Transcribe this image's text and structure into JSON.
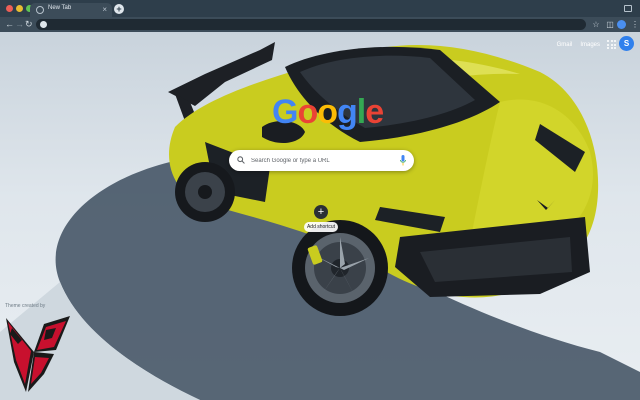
{
  "browser": {
    "tab": {
      "title": "New Tab",
      "close_glyph": "×"
    },
    "new_tab_glyph": "+",
    "omnibox": {
      "value": "",
      "placeholder": ""
    },
    "nav": {
      "back_glyph": "←",
      "forward_glyph": "→",
      "reload_glyph": "↻"
    },
    "toolbar_icons": [
      "bookmark-star-icon",
      "extensions-icon"
    ]
  },
  "ntp": {
    "links": {
      "gmail": "Gmail",
      "images": "Images"
    },
    "account_initial": "S",
    "logo_letters": [
      "G",
      "o",
      "o",
      "g",
      "l",
      "e"
    ],
    "search": {
      "placeholder": "Search Google or type a URL"
    },
    "shortcut": {
      "label": "Add shortcut",
      "glyph": "+"
    },
    "theme_credit": "Theme created by"
  },
  "colors": {
    "google_blue": "#4285f4",
    "google_red": "#ea4335",
    "google_yellow": "#fbbc05",
    "google_green": "#34a853",
    "car_yellow": "#cfd11f",
    "logo_red": "#c8102e"
  }
}
